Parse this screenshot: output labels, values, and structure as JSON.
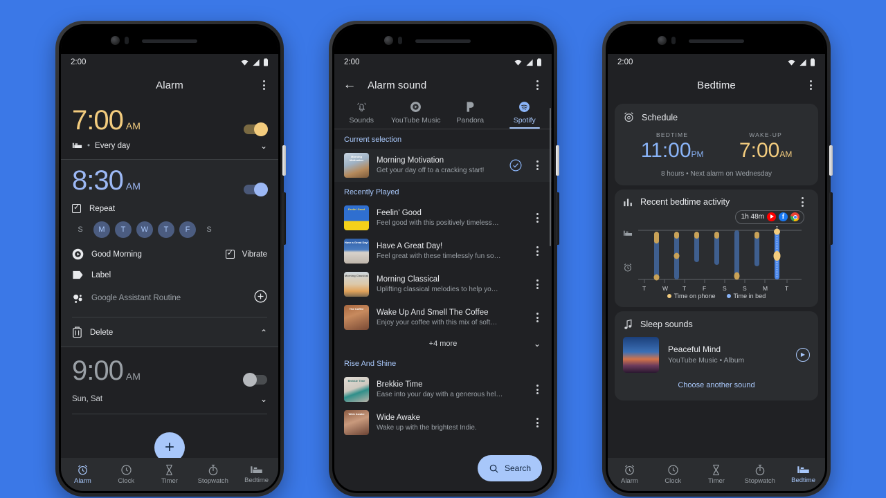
{
  "background_color": "#3b78e7",
  "status_bar": {
    "time": "2:00",
    "icons": [
      "wifi-icon",
      "signal-icon",
      "battery-icon"
    ]
  },
  "bottom_nav": {
    "items": [
      {
        "label": "Alarm",
        "icon": "alarm-clock-icon"
      },
      {
        "label": "Clock",
        "icon": "clock-icon"
      },
      {
        "label": "Timer",
        "icon": "hourglass-icon"
      },
      {
        "label": "Stopwatch",
        "icon": "stopwatch-icon"
      },
      {
        "label": "Bedtime",
        "icon": "bed-icon"
      }
    ]
  },
  "phone1": {
    "title": "Alarm",
    "menu_icon": "overflow-menu-icon",
    "active_nav": "Alarm",
    "alarms": [
      {
        "time": "7:00",
        "ampm": "AM",
        "enabled": true,
        "accent": "#f3cc7e",
        "schedule": "Every day",
        "schedule_icon": "bed-icon",
        "expanded": false
      },
      {
        "time": "8:30",
        "ampm": "AM",
        "enabled": true,
        "accent": "#9cb8f5",
        "expanded": true,
        "repeat_label": "Repeat",
        "repeat_checked": true,
        "days": [
          {
            "letter": "S",
            "on": false
          },
          {
            "letter": "M",
            "on": true
          },
          {
            "letter": "T",
            "on": true
          },
          {
            "letter": "W",
            "on": true
          },
          {
            "letter": "T",
            "on": true
          },
          {
            "letter": "F",
            "on": true
          },
          {
            "letter": "S",
            "on": false
          }
        ],
        "sound_label": "Good Morning",
        "sound_icon": "play-disc-icon",
        "vibrate_label": "Vibrate",
        "vibrate_checked": true,
        "label_label": "Label",
        "label_icon": "tag-icon",
        "assistant_label": "Google Assistant Routine",
        "assistant_icon": "assistant-icon",
        "assistant_add_icon": "plus-circle-icon",
        "delete_label": "Delete",
        "delete_icon": "trash-icon",
        "collapse_icon": "chevron-up-icon"
      },
      {
        "time": "9:00",
        "ampm": "AM",
        "enabled": false,
        "accent": "#9aa0a6",
        "schedule": "Sun, Sat",
        "expanded": false
      }
    ],
    "fab_label": "+",
    "fab_name": "add-alarm-fab"
  },
  "phone2": {
    "title": "Alarm sound",
    "back_icon": "back-arrow-icon",
    "menu_icon": "overflow-menu-icon",
    "tabs": [
      {
        "label": "Sounds",
        "icon": "bell-icon",
        "active": false
      },
      {
        "label": "YouTube Music",
        "icon": "youtube-music-icon",
        "active": false
      },
      {
        "label": "Pandora",
        "icon": "pandora-icon",
        "active": false
      },
      {
        "label": "Spotify",
        "icon": "spotify-icon",
        "active": true
      }
    ],
    "sections": [
      {
        "heading": "Current selection",
        "tracks": [
          {
            "title": "Morning Motivation",
            "subtitle": "Get your day off to a cracking start!",
            "selected": true,
            "art_label": "Morning Motivation",
            "art_colors": [
              "#cfd8e2",
              "#b08a63"
            ]
          }
        ]
      },
      {
        "heading": "Recently Played",
        "tracks": [
          {
            "title": "Feelin' Good",
            "subtitle": "Feel good with this positively timeless…",
            "art_label": "Feelin' Good",
            "art_colors": [
              "#2f6fd0",
              "#f4d11a"
            ]
          },
          {
            "title": "Have A Great Day!",
            "subtitle": "Feel great with these timelessly fun so…",
            "art_label": "Have a Great Day!",
            "art_colors": [
              "#2f5fa8",
              "#d8d2cb"
            ]
          },
          {
            "title": "Morning Classical",
            "subtitle": "Uplifting classical melodies to help yo…",
            "art_label": "Morning Classical",
            "art_colors": [
              "#cdd6dd",
              "#e0a25a"
            ]
          },
          {
            "title": "Wake Up And Smell The Coffee",
            "subtitle": "Enjoy your coffee with this mix of soft…",
            "art_label": "The Coffee",
            "art_colors": [
              "#7a4a35",
              "#c78a5e"
            ]
          }
        ],
        "more_label": "+4 more",
        "more_icon": "chevron-down-icon"
      },
      {
        "heading": "Rise And Shine",
        "tracks": [
          {
            "title": "Brekkie Time",
            "subtitle": "Ease into your day with a generous hel…",
            "art_label": "Brekkie Time",
            "art_colors": [
              "#d7d2cc",
              "#2f8f8a"
            ]
          },
          {
            "title": "Wide Awake",
            "subtitle": "Wake up with the brightest Indie.",
            "art_label": "Wide Awake",
            "art_colors": [
              "#6b4334",
              "#c99a7d"
            ]
          }
        ]
      }
    ],
    "fab": {
      "label": "Search",
      "icon": "search-icon"
    },
    "track_menu_icon": "overflow-menu-icon",
    "selected_icon": "check-circle-icon"
  },
  "phone3": {
    "title": "Bedtime",
    "menu_icon": "overflow-menu-icon",
    "active_nav": "Bedtime",
    "schedule_card": {
      "heading": "Schedule",
      "icon": "alarm-clock-icon",
      "bedtime_label": "BEDTIME",
      "bedtime_value": "11:00",
      "bedtime_ampm": "PM",
      "bedtime_color": "#8ab4f8",
      "wakeup_label": "WAKE-UP",
      "wakeup_value": "7:00",
      "wakeup_ampm": "AM",
      "wakeup_color": "#f3cc7e",
      "note": "8 hours • Next alarm on Wednesday"
    },
    "activity_card": {
      "heading": "Recent bedtime activity",
      "icon": "bar-chart-icon",
      "menu_icon": "overflow-menu-icon",
      "badge": {
        "duration": "1h 48m",
        "apps": [
          "youtube-icon",
          "facebook-icon",
          "chrome-icon"
        ]
      },
      "bed_icon": "bed-icon",
      "alarm_icon": "alarm-clock-icon",
      "legend": [
        {
          "label": "Time on phone",
          "color": "#f3cc7e"
        },
        {
          "label": "Time in bed",
          "color": "#8ab4f8"
        }
      ]
    },
    "sleep_card": {
      "heading": "Sleep sounds",
      "icon": "music-note-icon",
      "track_title": "Peaceful Mind",
      "track_subtitle": "YouTube Music • Album",
      "play_icon": "play-circle-icon",
      "choose_label": "Choose another sound"
    }
  },
  "chart_data": {
    "type": "bar",
    "title": "Recent bedtime activity",
    "categories": [
      "T",
      "W",
      "T",
      "F",
      "S",
      "S",
      "M",
      "T"
    ],
    "xlabel": "",
    "ylabel": "",
    "grid": false,
    "legend_position": "bottom",
    "series": [
      {
        "name": "Time in bed",
        "color": "#8ab4f8",
        "bars": [
          {
            "day": "T-W",
            "start_pct": 8,
            "end_pct": 97
          },
          {
            "day": "W-T",
            "start_pct": 10,
            "end_pct": 99
          },
          {
            "day": "T-F",
            "start_pct": 12,
            "end_pct": 62
          },
          {
            "day": "F-S",
            "start_pct": 12,
            "end_pct": 68
          },
          {
            "day": "S-S",
            "start_pct": 5,
            "end_pct": 99
          },
          {
            "day": "S-M",
            "start_pct": 12,
            "end_pct": 72
          },
          {
            "day": "M-T",
            "start_pct": 3,
            "end_pct": 96,
            "current": true
          }
        ]
      },
      {
        "name": "Time on phone",
        "color": "#f3cc7e",
        "markers": [
          {
            "bar": 0,
            "pos_pct": 88
          },
          {
            "bar": 0,
            "pos_pct": 5
          },
          {
            "bar": 1,
            "pos_pct": 96
          },
          {
            "bar": 1,
            "pos_pct": 48
          },
          {
            "bar": 2,
            "pos_pct": 96
          },
          {
            "bar": 3,
            "pos_pct": 96
          },
          {
            "bar": 4,
            "pos_pct": 8
          },
          {
            "bar": 5,
            "pos_pct": 94
          },
          {
            "bar": 6,
            "pos_pct": 99
          },
          {
            "bar": 6,
            "pos_pct": 52
          }
        ]
      }
    ]
  }
}
